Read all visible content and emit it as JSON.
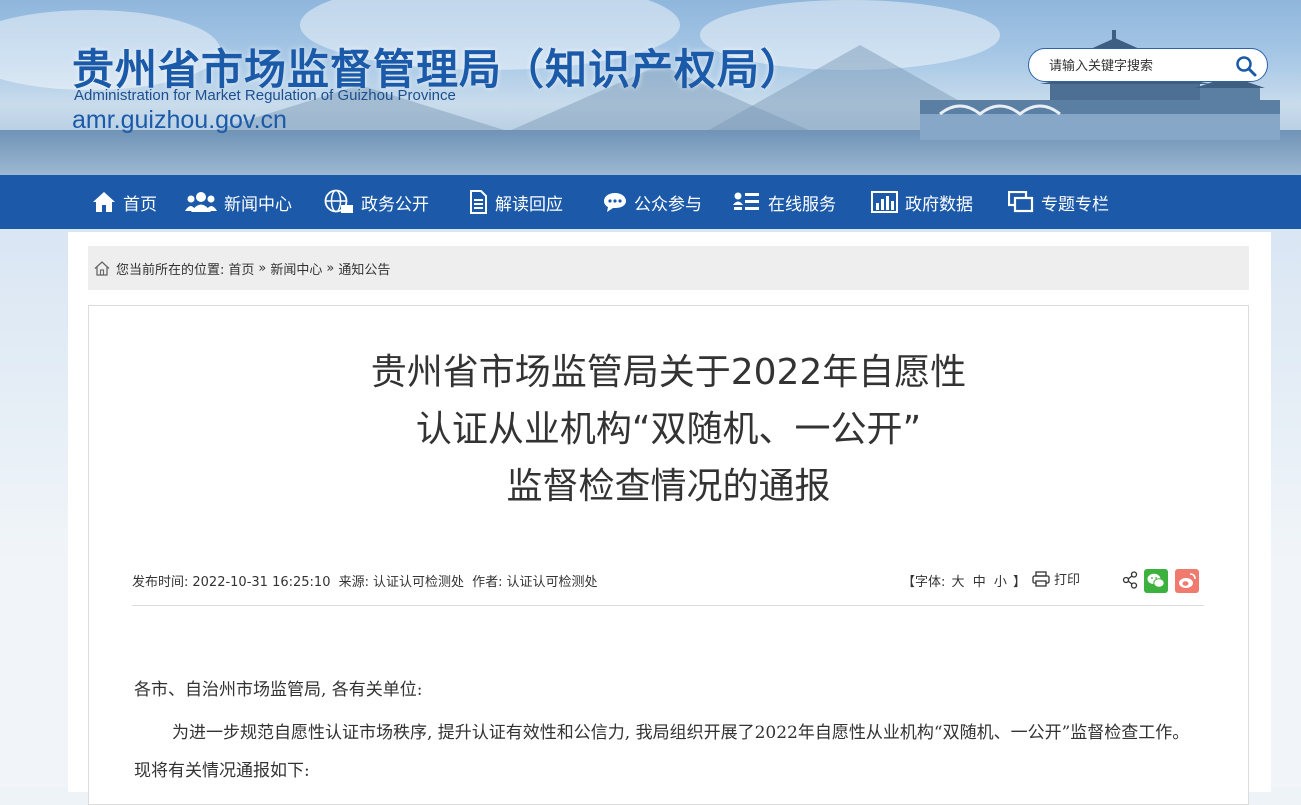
{
  "header": {
    "site_title": "贵州省市场监督管理局（知识产权局）",
    "site_title_en": "Administration for Market Regulation of Guizhou Province",
    "site_url": "amr.guizhou.gov.cn",
    "search_placeholder": "请输入关键字搜索"
  },
  "nav": {
    "items": [
      {
        "label": "首页",
        "icon": "home-icon"
      },
      {
        "label": "新闻中心",
        "icon": "users-icon"
      },
      {
        "label": "政务公开",
        "icon": "globe-icon"
      },
      {
        "label": "解读回应",
        "icon": "document-icon"
      },
      {
        "label": "公众参与",
        "icon": "chat-icon"
      },
      {
        "label": "在线服务",
        "icon": "list-icon"
      },
      {
        "label": "政府数据",
        "icon": "bar-chart-icon"
      },
      {
        "label": "专题专栏",
        "icon": "window-icon"
      }
    ]
  },
  "breadcrumb": {
    "prefix": "您当前所在的位置:",
    "items": [
      "首页",
      "新闻中心",
      "通知公告"
    ],
    "separator": "»"
  },
  "article": {
    "title_lines": [
      "贵州省市场监管局关于2022年自愿性",
      "认证从业机构“双随机、一公开”",
      "监督检查情况的通报"
    ],
    "meta": {
      "publish_label": "发布时间:",
      "publish_time": "2022-10-31 16:25:10",
      "source_label": "来源:",
      "source": "认证认可检测处",
      "author_label": "作者:",
      "author": "认证认可检测处",
      "font_label_open": "【字体:",
      "font_large": "大",
      "font_medium": "中",
      "font_small": "小",
      "font_label_close": "】",
      "print_label": "打印"
    },
    "paragraphs": [
      "各市、自治州市场监管局, 各有关单位:",
      "为进一步规范自愿性认证市场秩序, 提升认证有效性和公信力, 我局组织开展了2022年自愿性从业机构“双随机、一公开”监督检查工作。现将有关情况通报如下:"
    ]
  },
  "colors": {
    "nav_bg": "#1c5aa9",
    "title_blue": "#1b5aa8",
    "wechat": "#3db13d",
    "weibo": "#f07a6e"
  }
}
